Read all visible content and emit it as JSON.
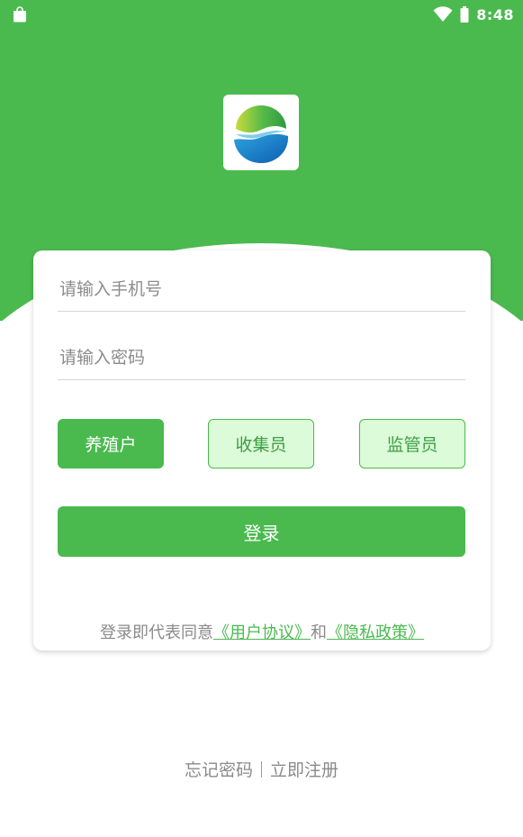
{
  "status_bar": {
    "time": "8:48",
    "left_icon": "shopping-bag-icon",
    "wifi_icon": "wifi-icon",
    "battery_icon": "battery-icon"
  },
  "logo": {
    "icon": "app-logo-icon"
  },
  "form": {
    "phone_placeholder": "请输入手机号",
    "phone_value": "",
    "password_placeholder": "请输入密码",
    "password_value": ""
  },
  "roles": {
    "farmer_label": "养殖户",
    "collector_label": "收集员",
    "supervisor_label": "监管员",
    "selected": "养殖户"
  },
  "login": {
    "label": "登录"
  },
  "agreement": {
    "prefix": "登录即代表同意",
    "user_agreement": "《用户协议》",
    "connector": "和",
    "privacy_policy": "《隐私政策》"
  },
  "footer": {
    "forgot_password": "忘记密码",
    "register": "立即注册"
  },
  "colors": {
    "primary": "#4aba4f",
    "role_inactive_bg": "#dcfbd9",
    "text_gray": "#8a8a8a"
  }
}
